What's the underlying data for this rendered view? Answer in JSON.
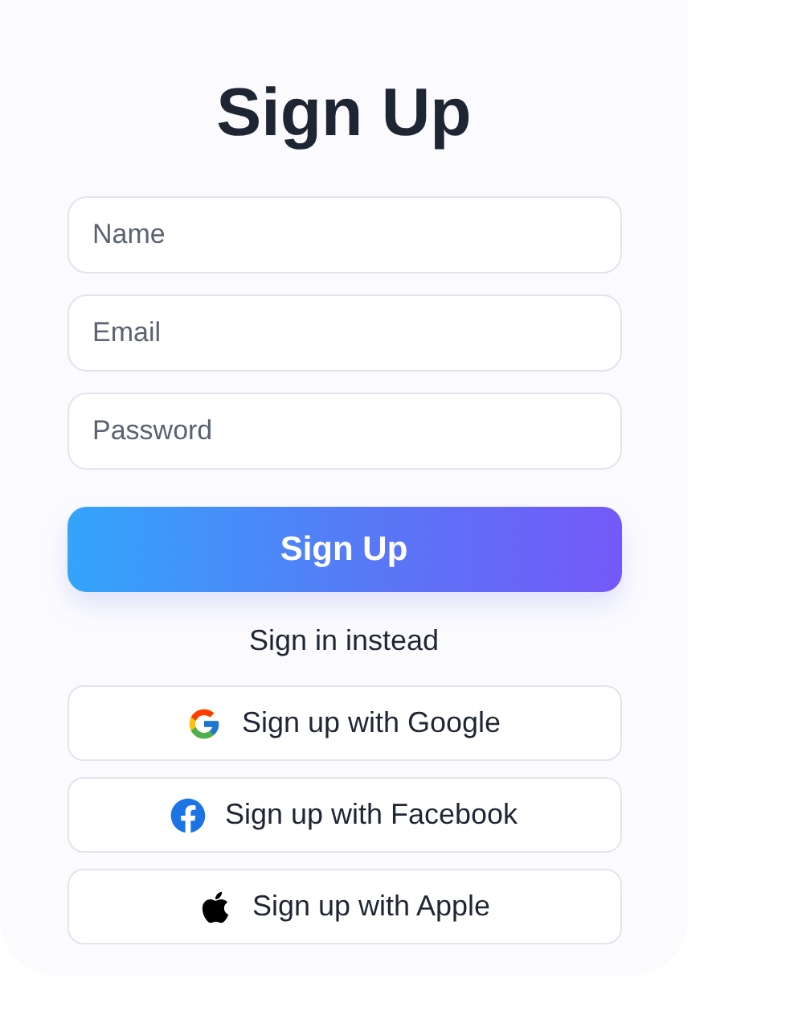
{
  "title": "Sign Up",
  "fields": [
    {
      "placeholder": "Name"
    },
    {
      "placeholder": "Email"
    },
    {
      "placeholder": "Password"
    }
  ],
  "submit": "Sign Up",
  "switch_link": "Sign in instead",
  "social_buttons": [
    {
      "kind": "google",
      "label": "Sign up with Google"
    },
    {
      "kind": "facebook",
      "label": "Sign up with Facebook"
    },
    {
      "kind": "apple",
      "label": "Sign up with Apple"
    }
  ]
}
